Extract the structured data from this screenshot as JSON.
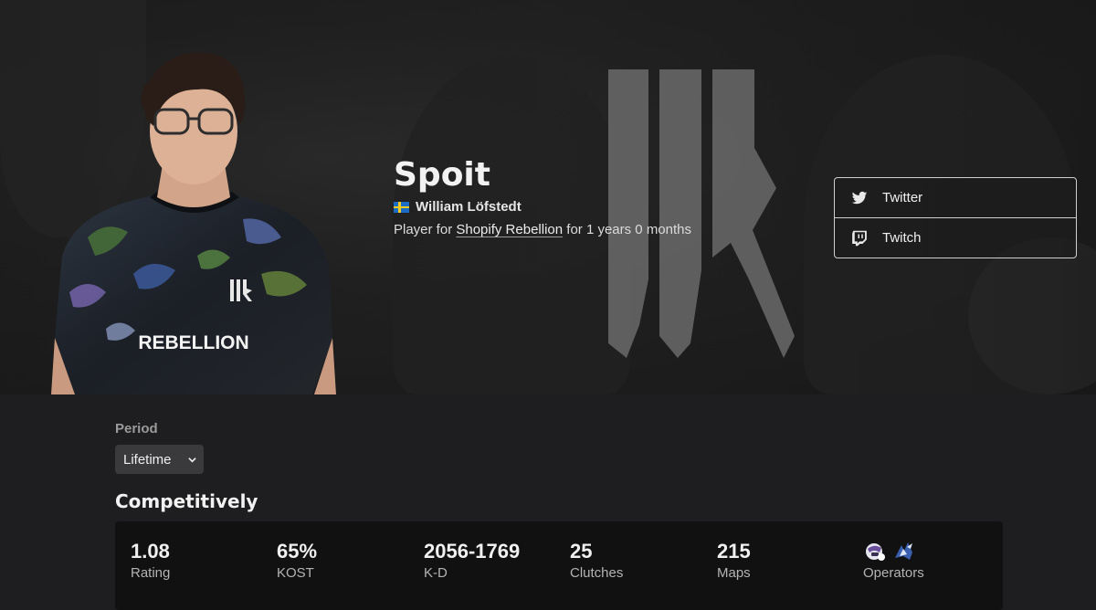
{
  "player": {
    "nickname": "Spoit",
    "real_name": "William Löfstedt",
    "team_prefix": "Player for ",
    "team_name": "Shopify Rebellion",
    "team_suffix": " for 1 years 0 months",
    "jersey_text": "REBELLION"
  },
  "social": [
    {
      "label": "Twitter",
      "icon": "twitter-icon"
    },
    {
      "label": "Twitch",
      "icon": "twitch-icon"
    }
  ],
  "filters": {
    "period_label": "Period",
    "period_value": "Lifetime"
  },
  "section_heading": "Competitively",
  "stats": [
    {
      "value": "1.08",
      "label": "Rating"
    },
    {
      "value": "65%",
      "label": "KOST"
    },
    {
      "value": "2056-1769",
      "label": "K-D"
    },
    {
      "value": "25",
      "label": "Clutches"
    },
    {
      "value": "215",
      "label": "Maps"
    }
  ],
  "operators": {
    "label": "Operators",
    "icons": [
      "operator-1-icon",
      "operator-2-icon"
    ]
  },
  "colors": {
    "page_bg": "#1e1e20",
    "card_bg": "#111112",
    "select_bg": "#3a3a3c",
    "swedish_blue": "#1b6cc4",
    "swedish_yellow": "#f5cc1e"
  }
}
